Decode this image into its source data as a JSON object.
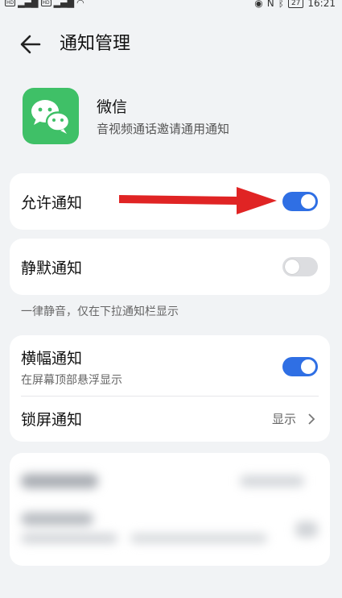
{
  "status_bar": {
    "left_tags": [
      "HD",
      "HD"
    ],
    "network": "4G",
    "time": "16:21",
    "battery": "27"
  },
  "header": {
    "title": "通知管理"
  },
  "app": {
    "name": "微信",
    "description": "音视频通话邀请通用通知",
    "icon": "wechat-icon"
  },
  "settings": {
    "allow": {
      "label": "允许通知",
      "enabled": true
    },
    "silent": {
      "label": "静默通知",
      "enabled": false
    },
    "silent_note": "一律静音，仅在下拉通知栏显示",
    "banner": {
      "label": "横幅通知",
      "sublabel": "在屏幕顶部悬浮显示",
      "enabled": true
    },
    "lockscreen": {
      "label": "锁屏通知",
      "value": "显示"
    }
  },
  "colors": {
    "accent": "#2f6fe4",
    "app_green": "#3fc067",
    "arrow_red": "#e02424"
  }
}
